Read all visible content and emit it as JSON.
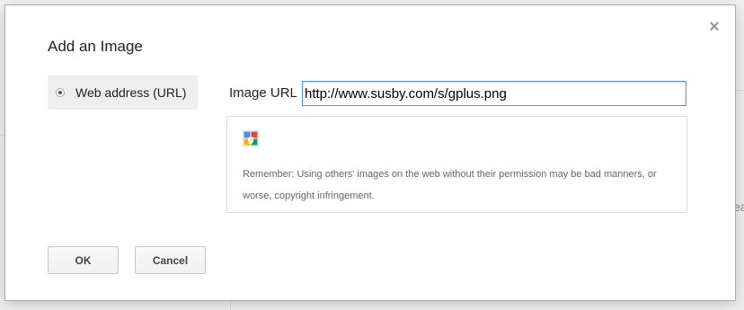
{
  "dialog": {
    "title": "Add an Image",
    "close_label": "×",
    "source_tab_label": "Web address (URL)",
    "url_label": "Image URL",
    "url_value": "http://www.susby.com/s/gplus.png",
    "preview_icon": "google-plus-icon",
    "remember_text": "Remember: Using others' images on the web without their permission may be bad manners, or worse, copyright infringement.",
    "ok_label": "OK",
    "cancel_label": "Cancel"
  },
  "backdrop": {
    "edge_text": "ea"
  },
  "colors": {
    "focus_border": "#4d90fe",
    "tab_background": "#eeeeee"
  }
}
